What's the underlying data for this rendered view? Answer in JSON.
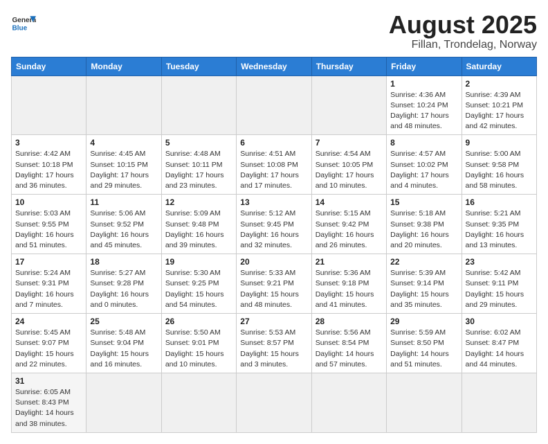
{
  "logo": {
    "text_general": "General",
    "text_blue": "Blue"
  },
  "title": {
    "month_year": "August 2025",
    "location": "Fillan, Trondelag, Norway"
  },
  "weekdays": [
    "Sunday",
    "Monday",
    "Tuesday",
    "Wednesday",
    "Thursday",
    "Friday",
    "Saturday"
  ],
  "weeks": [
    [
      {
        "day": "",
        "info": ""
      },
      {
        "day": "",
        "info": ""
      },
      {
        "day": "",
        "info": ""
      },
      {
        "day": "",
        "info": ""
      },
      {
        "day": "",
        "info": ""
      },
      {
        "day": "1",
        "info": "Sunrise: 4:36 AM\nSunset: 10:24 PM\nDaylight: 17 hours\nand 48 minutes."
      },
      {
        "day": "2",
        "info": "Sunrise: 4:39 AM\nSunset: 10:21 PM\nDaylight: 17 hours\nand 42 minutes."
      }
    ],
    [
      {
        "day": "3",
        "info": "Sunrise: 4:42 AM\nSunset: 10:18 PM\nDaylight: 17 hours\nand 36 minutes."
      },
      {
        "day": "4",
        "info": "Sunrise: 4:45 AM\nSunset: 10:15 PM\nDaylight: 17 hours\nand 29 minutes."
      },
      {
        "day": "5",
        "info": "Sunrise: 4:48 AM\nSunset: 10:11 PM\nDaylight: 17 hours\nand 23 minutes."
      },
      {
        "day": "6",
        "info": "Sunrise: 4:51 AM\nSunset: 10:08 PM\nDaylight: 17 hours\nand 17 minutes."
      },
      {
        "day": "7",
        "info": "Sunrise: 4:54 AM\nSunset: 10:05 PM\nDaylight: 17 hours\nand 10 minutes."
      },
      {
        "day": "8",
        "info": "Sunrise: 4:57 AM\nSunset: 10:02 PM\nDaylight: 17 hours\nand 4 minutes."
      },
      {
        "day": "9",
        "info": "Sunrise: 5:00 AM\nSunset: 9:58 PM\nDaylight: 16 hours\nand 58 minutes."
      }
    ],
    [
      {
        "day": "10",
        "info": "Sunrise: 5:03 AM\nSunset: 9:55 PM\nDaylight: 16 hours\nand 51 minutes."
      },
      {
        "day": "11",
        "info": "Sunrise: 5:06 AM\nSunset: 9:52 PM\nDaylight: 16 hours\nand 45 minutes."
      },
      {
        "day": "12",
        "info": "Sunrise: 5:09 AM\nSunset: 9:48 PM\nDaylight: 16 hours\nand 39 minutes."
      },
      {
        "day": "13",
        "info": "Sunrise: 5:12 AM\nSunset: 9:45 PM\nDaylight: 16 hours\nand 32 minutes."
      },
      {
        "day": "14",
        "info": "Sunrise: 5:15 AM\nSunset: 9:42 PM\nDaylight: 16 hours\nand 26 minutes."
      },
      {
        "day": "15",
        "info": "Sunrise: 5:18 AM\nSunset: 9:38 PM\nDaylight: 16 hours\nand 20 minutes."
      },
      {
        "day": "16",
        "info": "Sunrise: 5:21 AM\nSunset: 9:35 PM\nDaylight: 16 hours\nand 13 minutes."
      }
    ],
    [
      {
        "day": "17",
        "info": "Sunrise: 5:24 AM\nSunset: 9:31 PM\nDaylight: 16 hours\nand 7 minutes."
      },
      {
        "day": "18",
        "info": "Sunrise: 5:27 AM\nSunset: 9:28 PM\nDaylight: 16 hours\nand 0 minutes."
      },
      {
        "day": "19",
        "info": "Sunrise: 5:30 AM\nSunset: 9:25 PM\nDaylight: 15 hours\nand 54 minutes."
      },
      {
        "day": "20",
        "info": "Sunrise: 5:33 AM\nSunset: 9:21 PM\nDaylight: 15 hours\nand 48 minutes."
      },
      {
        "day": "21",
        "info": "Sunrise: 5:36 AM\nSunset: 9:18 PM\nDaylight: 15 hours\nand 41 minutes."
      },
      {
        "day": "22",
        "info": "Sunrise: 5:39 AM\nSunset: 9:14 PM\nDaylight: 15 hours\nand 35 minutes."
      },
      {
        "day": "23",
        "info": "Sunrise: 5:42 AM\nSunset: 9:11 PM\nDaylight: 15 hours\nand 29 minutes."
      }
    ],
    [
      {
        "day": "24",
        "info": "Sunrise: 5:45 AM\nSunset: 9:07 PM\nDaylight: 15 hours\nand 22 minutes."
      },
      {
        "day": "25",
        "info": "Sunrise: 5:48 AM\nSunset: 9:04 PM\nDaylight: 15 hours\nand 16 minutes."
      },
      {
        "day": "26",
        "info": "Sunrise: 5:50 AM\nSunset: 9:01 PM\nDaylight: 15 hours\nand 10 minutes."
      },
      {
        "day": "27",
        "info": "Sunrise: 5:53 AM\nSunset: 8:57 PM\nDaylight: 15 hours\nand 3 minutes."
      },
      {
        "day": "28",
        "info": "Sunrise: 5:56 AM\nSunset: 8:54 PM\nDaylight: 14 hours\nand 57 minutes."
      },
      {
        "day": "29",
        "info": "Sunrise: 5:59 AM\nSunset: 8:50 PM\nDaylight: 14 hours\nand 51 minutes."
      },
      {
        "day": "30",
        "info": "Sunrise: 6:02 AM\nSunset: 8:47 PM\nDaylight: 14 hours\nand 44 minutes."
      }
    ],
    [
      {
        "day": "31",
        "info": "Sunrise: 6:05 AM\nSunset: 8:43 PM\nDaylight: 14 hours\nand 38 minutes."
      },
      {
        "day": "",
        "info": ""
      },
      {
        "day": "",
        "info": ""
      },
      {
        "day": "",
        "info": ""
      },
      {
        "day": "",
        "info": ""
      },
      {
        "day": "",
        "info": ""
      },
      {
        "day": "",
        "info": ""
      }
    ]
  ]
}
